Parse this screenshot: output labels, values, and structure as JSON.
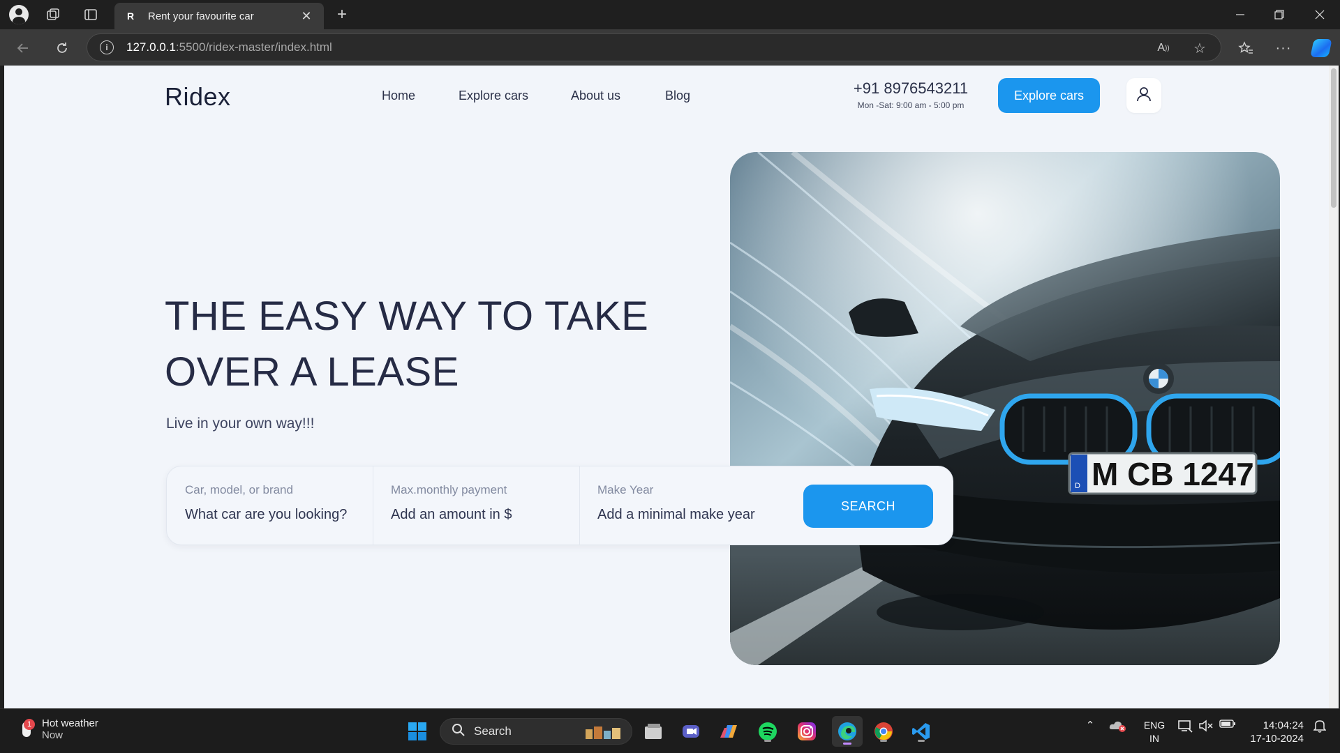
{
  "browser": {
    "tab_title": "Rent your favourite car",
    "tab_favicon": "R",
    "url_host": "127.0.0.1",
    "url_path": ":5500/ridex-master/index.html"
  },
  "site": {
    "logo": "Ridex",
    "nav": [
      "Home",
      "Explore cars",
      "About us",
      "Blog"
    ],
    "phone": "+91 8976543211",
    "hours": "Mon -Sat: 9:00 am - 5:00 pm",
    "explore_button": "Explore cars",
    "user_icon": "user-icon"
  },
  "hero": {
    "title_line1": "THE EASY WAY TO TAKE",
    "title_line2": "OVER A LEASE",
    "subtitle": "Live in your own way!!!",
    "plate": "M CB 1247"
  },
  "search": {
    "fields": [
      {
        "label": "Car, model, or brand",
        "placeholder": "What car are you looking?"
      },
      {
        "label": "Max.monthly payment",
        "placeholder": "Add an amount in $"
      },
      {
        "label": "Make Year",
        "placeholder": "Add a minimal make year"
      }
    ],
    "button": "SEARCH"
  },
  "taskbar": {
    "weather_title": "Hot weather",
    "weather_sub": "Now",
    "weather_badge": "1",
    "search_label": "Search",
    "lang_line1": "ENG",
    "lang_line2": "IN",
    "time": "14:04:24",
    "date": "17-10-2024"
  },
  "colors": {
    "accent": "#1b96ee",
    "page_bg": "#f2f5fa",
    "heading": "#262b45"
  }
}
